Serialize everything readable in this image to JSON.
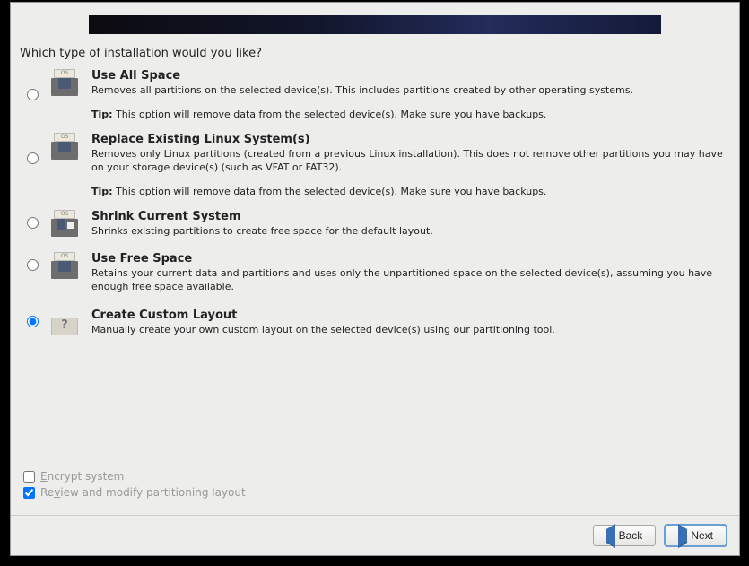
{
  "prompt": "Which type of installation would you like?",
  "options": [
    {
      "id": "use-all-space",
      "title": "Use All Space",
      "desc": "Removes all partitions on the selected device(s).  This includes partitions created by other operating systems.",
      "tip_label": "Tip:",
      "tip": " This option will remove data from the selected device(s).  Make sure you have backups.",
      "selected": false,
      "icon": "disk"
    },
    {
      "id": "replace-linux",
      "title": "Replace Existing Linux System(s)",
      "desc": "Removes only Linux partitions (created from a previous Linux installation).  This does not remove other partitions you may have on your storage device(s) (such as VFAT or FAT32).",
      "tip_label": "Tip:",
      "tip": " This option will remove data from the selected device(s).  Make sure you have backups.",
      "selected": false,
      "icon": "disk"
    },
    {
      "id": "shrink-current",
      "title": "Shrink Current System",
      "desc": "Shrinks existing partitions to create free space for the default layout.",
      "selected": false,
      "icon": "shrink"
    },
    {
      "id": "use-free-space",
      "title": "Use Free Space",
      "desc": "Retains your current data and partitions and uses only the unpartitioned space on the selected device(s), assuming you have enough free space available.",
      "selected": false,
      "icon": "disk"
    },
    {
      "id": "custom-layout",
      "title": "Create Custom Layout",
      "desc": "Manually create your own custom layout on the selected device(s) using our partitioning tool.",
      "selected": true,
      "icon": "custom"
    }
  ],
  "checks": {
    "encrypt": {
      "label_pre": "E",
      "label_post": "ncrypt system",
      "checked": false
    },
    "review": {
      "label_pre": "Re",
      "label_u": "v",
      "label_post": "iew and modify partitioning layout",
      "checked": true
    }
  },
  "buttons": {
    "back_u": "B",
    "back_post": "ack",
    "next_u": "N",
    "next_post": "ext"
  },
  "os_label": "OS"
}
